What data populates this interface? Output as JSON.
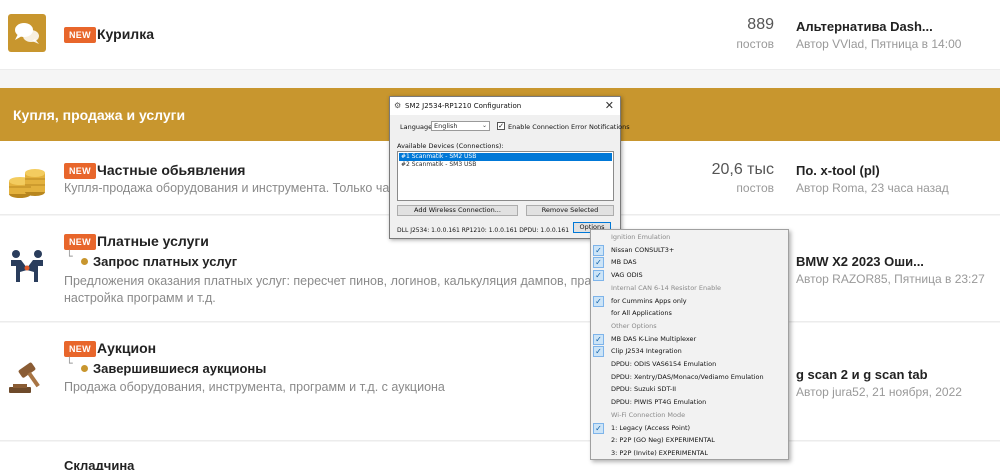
{
  "forums": {
    "kurilka": {
      "badge": "NEW",
      "title": "Курилка",
      "count": "889",
      "count_label": "постов",
      "last_title": "Альтернатива Dash...",
      "last_meta": "Автор VVlad, Пятница в 14:00"
    },
    "section_title": "Купля, продажа и услуги",
    "chastnye": {
      "badge": "NEW",
      "title": "Частные обьявления",
      "desc": "Купля-продажа оборудования и инструмента. Только частн",
      "count": "20,6 тыс",
      "count_label": "постов",
      "last_title": "По. x-tool (pl)",
      "last_meta": "Автор Roma, 23 часа назад"
    },
    "platnye": {
      "badge": "NEW",
      "title": "Платные услуги",
      "tree": "└",
      "sub": "Запрос платных услуг",
      "desc1": "Предложения оказания платных услуг: пересчет пинов, логинов, калькуляция дампов, правка пр",
      "desc2": "настройка программ и т.д.",
      "last_title": "BMW X2 2023 Оши...",
      "last_meta": "Автор RAZOR85, Пятница в 23:27"
    },
    "auction": {
      "badge": "NEW",
      "title": "Аукцион",
      "tree": "└",
      "sub": "Завершившиеся аукционы",
      "desc": "Продажа оборудования, инструмента, программ и т.д. с аукциона",
      "last_title": "g scan 2 и g scan tab",
      "last_meta": "Автор jura52, 21 ноября, 2022"
    },
    "skladchina": {
      "title": "Складчина"
    }
  },
  "dialog": {
    "title": "SM2 J2534-RP1210 Configuration",
    "language_label": "Language",
    "language_value": "English",
    "enable_error_label": "Enable Connection Error Notifications",
    "devices_label": "Available Devices (Connections):",
    "devices": [
      "#1 Scanmatik - SM2 USB",
      "#2 Scanmatik - SM3 USB"
    ],
    "add_wireless": "Add Wireless Connection...",
    "remove_selected": "Remove Selected",
    "dll_info": "DLL J2534: 1.0.0.161 RP1210: 1.0.0.161 DPDU: 1.0.0.161",
    "options": "Options"
  },
  "menu": {
    "items": [
      {
        "label": "Ignition Emulation",
        "header": true,
        "checked": false
      },
      {
        "label": "Nissan CONSULT3+",
        "header": false,
        "checked": true
      },
      {
        "label": "MB DAS",
        "header": false,
        "checked": true
      },
      {
        "label": "VAG ODIS",
        "header": false,
        "checked": true
      },
      {
        "label": "Internal CAN 6-14 Resistor Enable",
        "header": true,
        "checked": false
      },
      {
        "label": "for Cummins Apps only",
        "header": false,
        "checked": true
      },
      {
        "label": "for All Applications",
        "header": false,
        "checked": false
      },
      {
        "label": "Other Options",
        "header": true,
        "checked": false
      },
      {
        "label": "MB DAS K-Line Multiplexer",
        "header": false,
        "checked": true
      },
      {
        "label": "Clip J2534 Integration",
        "header": false,
        "checked": true
      },
      {
        "label": "DPDU: ODIS VAS6154 Emulation",
        "header": false,
        "checked": false
      },
      {
        "label": "DPDU: Xentry/DAS/Monaco/Vediamo Emulation",
        "header": false,
        "checked": false
      },
      {
        "label": "DPDU: Suzuki SDT-II",
        "header": false,
        "checked": false
      },
      {
        "label": "DPDU: PIWIS PT4G Emulation",
        "header": false,
        "checked": false
      },
      {
        "label": "Wi-Fi Connection Mode",
        "header": true,
        "checked": false
      },
      {
        "label": "1: Legacy (Access Point)",
        "header": false,
        "checked": true
      },
      {
        "label": "2: P2P (GO Neg) EXPERIMENTAL",
        "header": false,
        "checked": false
      },
      {
        "label": "3: P2P (Invite) EXPERIMENTAL",
        "header": false,
        "checked": false
      }
    ]
  },
  "colors": {
    "accent": "#c8962e",
    "badge": "#e8662b",
    "selection": "#0078d7"
  },
  "icons": {
    "kurilka": "chat-bubbles-icon",
    "chastnye": "coins-icon",
    "platnye": "handshake-icon",
    "auction": "gavel-icon"
  }
}
